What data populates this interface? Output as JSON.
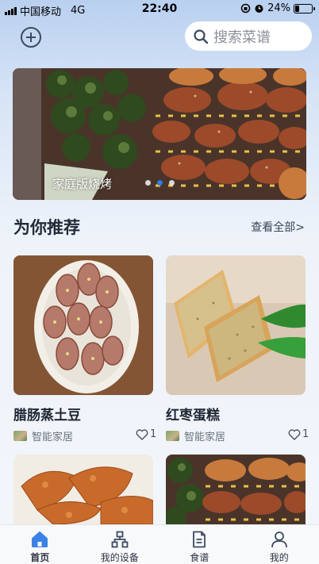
{
  "status_bar": {
    "carrier": "中国移动",
    "network": "4G",
    "time": "22:40",
    "battery_text": "24%",
    "battery_level": 0.24
  },
  "header": {
    "search_placeholder": "搜索菜谱",
    "add_icon": "plus-circle-icon",
    "search_icon": "search-icon"
  },
  "banner": {
    "caption": "家庭版烧烤",
    "dot_count": 3,
    "active_dot": 1
  },
  "section": {
    "title": "为你推荐",
    "see_all": "查看全部>"
  },
  "recipes": [
    {
      "title": "腊肠蒸土豆",
      "author": "智能家居",
      "likes": "1"
    },
    {
      "title": "红枣蛋糕",
      "author": "智能家居",
      "likes": "1"
    },
    {
      "title": "",
      "author": "",
      "likes": ""
    },
    {
      "title": "",
      "author": "",
      "likes": ""
    }
  ],
  "tabs": [
    {
      "label": "首页",
      "icon": "home-icon",
      "active": true
    },
    {
      "label": "我的设备",
      "icon": "devices-icon",
      "active": false
    },
    {
      "label": "食谱",
      "icon": "recipe-icon",
      "active": false
    },
    {
      "label": "我的",
      "icon": "user-icon",
      "active": false
    }
  ],
  "colors": {
    "accent": "#2d7be0",
    "tab_active": "#3b82e6",
    "tab_inactive": "#3c4a60"
  }
}
